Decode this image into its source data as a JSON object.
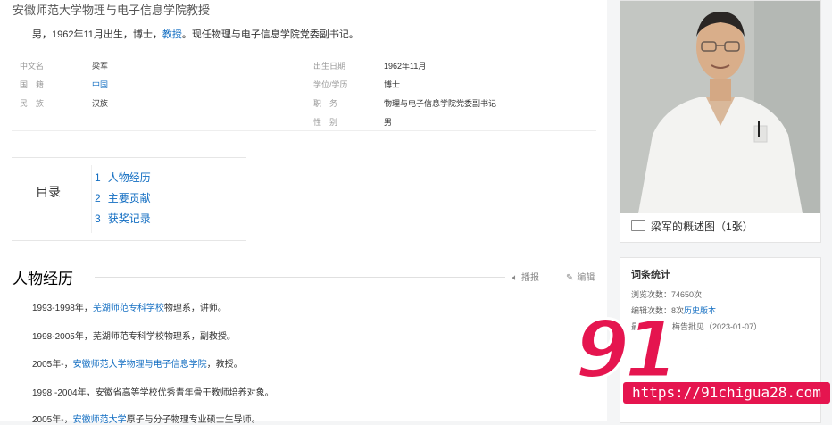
{
  "subtitle": "安徽师范大学物理与电子信息学院教授",
  "summary": {
    "text_before": "男，1962年11月出生，博士，",
    "link": "教授",
    "text_after": "。现任物理与电子信息学院党委副书记。"
  },
  "infobox": {
    "left": [
      {
        "key": "中文名",
        "value": "梁军",
        "link": false
      },
      {
        "key": "国　籍",
        "value": "中国",
        "link": true
      },
      {
        "key": "民　族",
        "value": "汉族",
        "link": false
      }
    ],
    "right": [
      {
        "key": "出生日期",
        "value": "1962年11月"
      },
      {
        "key": "学位/学历",
        "value": "博士"
      },
      {
        "key": "职　务",
        "value": "物理与电子信息学院党委副书记"
      },
      {
        "key": "性　别",
        "value": "男"
      }
    ]
  },
  "toc": {
    "title": "目录",
    "items": [
      {
        "num": "1",
        "label": "人物经历"
      },
      {
        "num": "2",
        "label": "主要贡献"
      },
      {
        "num": "3",
        "label": "获奖记录"
      }
    ]
  },
  "section": {
    "title": "人物经历",
    "actions": {
      "play_label": "播报",
      "edit_label": "编辑"
    }
  },
  "paragraphs": [
    {
      "before": "1993-1998年，",
      "link": "芜湖师范专科学校",
      "after": "物理系，讲师。"
    },
    {
      "before": "1998-2005年，芜湖师范专科学校物理系，副教授。",
      "link": "",
      "after": ""
    },
    {
      "before": "2005年-，",
      "link": "安徽师范大学物理与电子信息学院",
      "after": "，教授。"
    },
    {
      "before": "1998 -2004年，安徽省高等学校优秀青年骨干教师培养对象。",
      "link": "",
      "after": ""
    },
    {
      "before": "2005年-，",
      "link": "安徽师范大学",
      "after": "原子与分子物理专业硕士生导师。"
    }
  ],
  "photo": {
    "caption": "梁军的概述图（1张）",
    "icon": "image-icon"
  },
  "stats": {
    "title": "词条统计",
    "views_label": "浏览次数：",
    "views_value": "74650次",
    "edits_label": "编辑次数：",
    "edits_value": "8次",
    "edits_link": "历史版本",
    "last_label": "最近",
    "last_fragment": "梅告批见",
    "last_date": "（2023-01-07）"
  },
  "watermark": {
    "number": "91",
    "name": "吃瓜中心",
    "url": "https://91chigua28.com"
  },
  "colors": {
    "link": "#136ec2",
    "watermark": "#e5154f"
  }
}
